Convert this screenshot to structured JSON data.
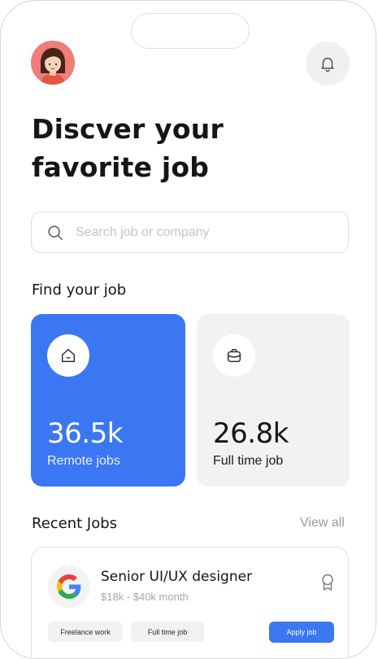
{
  "header": {
    "avatar_icon": "avatar-woman",
    "notification_icon": "bell-icon"
  },
  "hero": {
    "title_line1": "Discver your",
    "title_line2": "favorite job"
  },
  "search": {
    "placeholder": "Search job or company",
    "value": "",
    "icon": "search-icon"
  },
  "find_jobs": {
    "heading": "Find your job",
    "cards": [
      {
        "count": "36.5k",
        "label": "Remote jobs",
        "icon": "home-icon",
        "bg_color": "#3b77f2"
      },
      {
        "count": "26.8k",
        "label": "Full time job",
        "icon": "briefcase-icon",
        "bg_color": "#f2f2f2"
      }
    ]
  },
  "recent_jobs": {
    "heading": "Recent Jobs",
    "view_all": "View all",
    "items": [
      {
        "company_logo": "google-logo",
        "title": "Senior UI/UX designer",
        "salary": "$18k - $40k month",
        "tags": [
          "Freelance work",
          "Full time job"
        ],
        "apply_label": "Apply job",
        "bookmark_icon": "bookmark-icon"
      }
    ]
  },
  "colors": {
    "accent": "#3b77f2",
    "text": "#151515",
    "muted": "#a6a6a6"
  }
}
